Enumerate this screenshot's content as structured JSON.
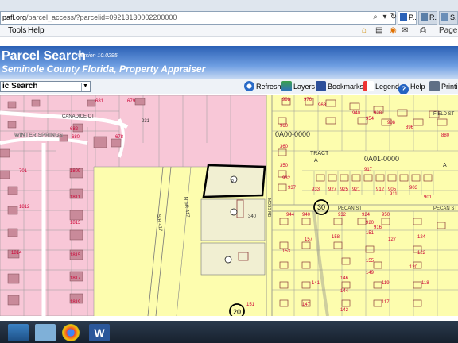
{
  "browser": {
    "url_host": "pafl.org",
    "url_path": "/parcel_access/?parcelid=09213130002200000",
    "tabs": [
      {
        "label": "P..."
      },
      {
        "label": "R..."
      },
      {
        "label": "S..."
      }
    ],
    "menu": {
      "tools": "Tools",
      "help": "Help"
    },
    "commands": {
      "page": "Page"
    }
  },
  "header": {
    "title": "Parcel Search",
    "version": "Version 10.0295",
    "subtitle": "Seminole County Florida, Property Appraiser"
  },
  "toolbar": {
    "search_mode": "ic Search",
    "refresh": "Refresh",
    "layers": "Layers",
    "bookmarks": "Bookmarks",
    "legend": "Legend",
    "help": "Help",
    "printing": "Printing"
  },
  "map": {
    "street_labels": {
      "canadice": "CANADICE CT",
      "winter_springs": "WINTER SPRINGS",
      "sr417": "S R 417",
      "hwy": "N SR 417",
      "moss": "MOSS RD",
      "pecan": "PECAN ST",
      "tract": "TRACT",
      "tract_a": "A",
      "field": "FIELD ST",
      "oa_main": "0A00-0000",
      "oa_sub": "0A01-0000"
    },
    "route_markers": [
      "30",
      "20"
    ],
    "parcel_numbers_left": [
      "681",
      "679",
      "231",
      "682",
      "680",
      "678",
      "1809",
      "1811",
      "1813",
      "1812",
      "1815",
      "1814",
      "1817",
      "1819",
      "701"
    ],
    "parcel_numbers_right": [
      "998",
      "976",
      "968",
      "940",
      "954",
      "928",
      "908",
      "896",
      "880",
      "960",
      "360",
      "350",
      "340",
      "932",
      "937",
      "933",
      "927",
      "925",
      "921",
      "917",
      "912",
      "905",
      "903",
      "901",
      "911",
      "907",
      "944",
      "940",
      "932",
      "924",
      "920",
      "950",
      "916",
      "157",
      "153",
      "158",
      "151",
      "127",
      "124",
      "122",
      "120",
      "118",
      "146",
      "141",
      "144",
      "142",
      "147",
      "119",
      "117",
      "151",
      "155",
      "149"
    ],
    "parcel_selected": "8",
    "parcel_center": "340"
  },
  "colors": {
    "residential": "#f8c7d7",
    "commercial": "#fdfdae",
    "banner": "#2b60b5",
    "parcel_number": "#cc0033"
  }
}
